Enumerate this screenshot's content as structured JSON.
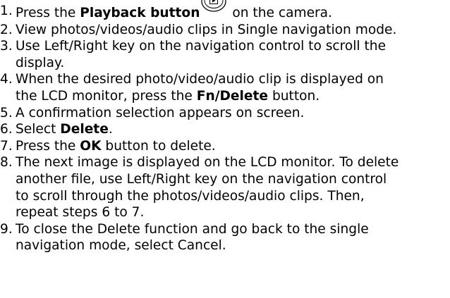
{
  "steps": [
    {
      "num": "1.",
      "lines": [
        {
          "pre": "Press the ",
          "bold": "Playback button",
          "icon": "playback-icon",
          "post": " on the camera."
        }
      ]
    },
    {
      "num": "2.",
      "lines": [
        {
          "pre": "View photos/videos/audio clips in Single navigation mode."
        }
      ]
    },
    {
      "num": "3.",
      "lines": [
        {
          "pre": "Use Left/Right key on the navigation control to scroll the"
        },
        {
          "pre": "display."
        }
      ]
    },
    {
      "num": "4.",
      "lines": [
        {
          "pre": "When the desired photo/video/audio clip is displayed on"
        },
        {
          "pre": "the LCD monitor, press the ",
          "bold": "Fn/Delete",
          "post": " button."
        }
      ]
    },
    {
      "num": "5.",
      "lines": [
        {
          "pre": "A confirmation selection appears on screen."
        }
      ]
    },
    {
      "num": "6.",
      "lines": [
        {
          "pre": "Select ",
          "bold": "Delete",
          "post": "."
        }
      ]
    },
    {
      "num": "7.",
      "lines": [
        {
          "pre": "Press the ",
          "bold": "OK",
          "post": " button to delete."
        }
      ]
    },
    {
      "num": "8.",
      "lines": [
        {
          "pre": "The next image is displayed on the LCD monitor. To delete"
        },
        {
          "pre": "another file, use Left/Right key on the navigation control"
        },
        {
          "pre": "to scroll through the photos/videos/audio clips. Then,"
        },
        {
          "pre": "repeat steps 6 to 7."
        }
      ]
    },
    {
      "num": "9.",
      "lines": [
        {
          "pre": "To close the Delete function and go back to the single"
        },
        {
          "pre": "navigation mode, select Cancel."
        }
      ]
    }
  ]
}
